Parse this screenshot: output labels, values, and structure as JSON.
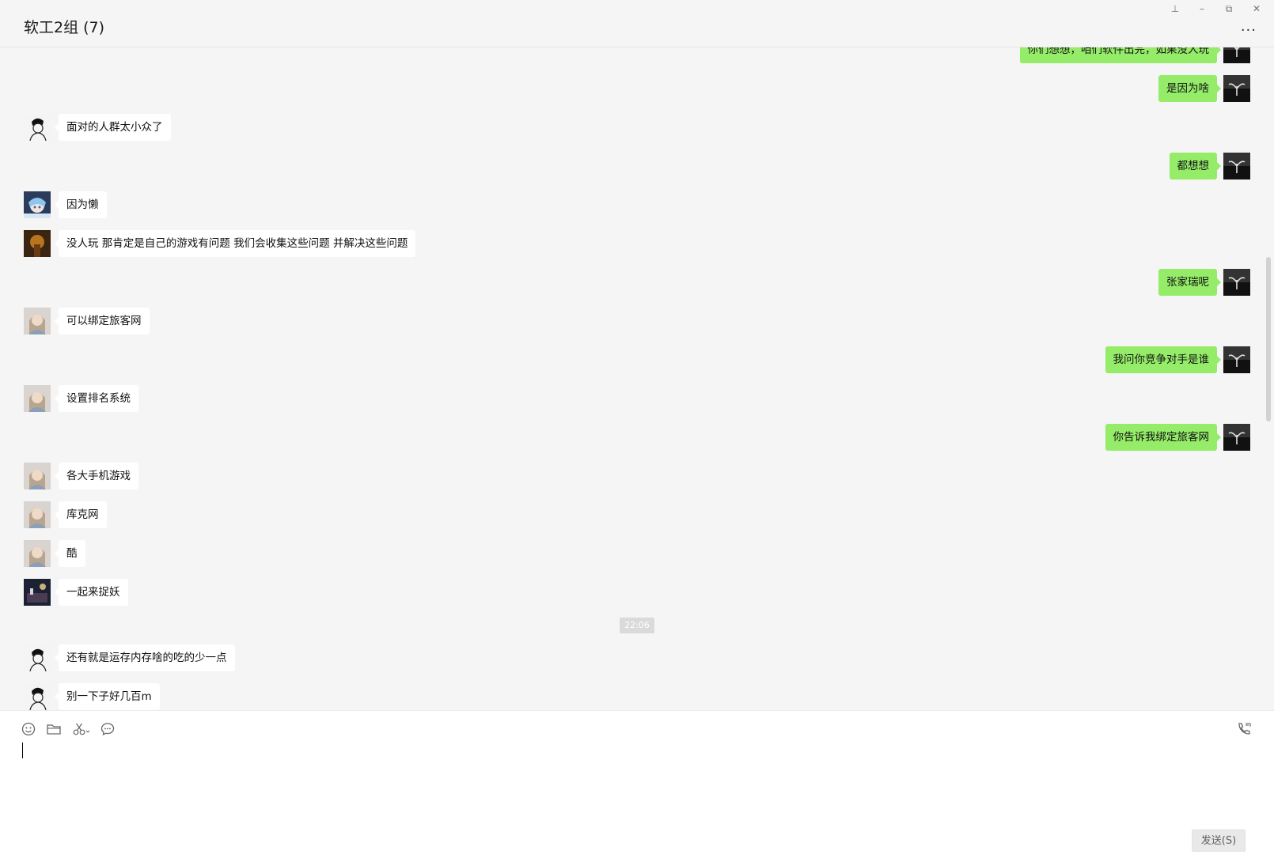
{
  "header": {
    "title": "软工2组 (7)",
    "controls": [
      {
        "name": "pin-icon",
        "glyph": "⊥"
      },
      {
        "name": "minimize-icon",
        "glyph": "–"
      },
      {
        "name": "restore-icon",
        "glyph": "⧉"
      },
      {
        "name": "close-icon",
        "glyph": "✕"
      }
    ],
    "more_glyph": "···"
  },
  "messages": [
    {
      "side": "right",
      "text": "你们想想，咱们软件出完，如果没人玩",
      "avatar": "dark-sprout"
    },
    {
      "side": "right",
      "text": "是因为啥",
      "avatar": "dark-sprout"
    },
    {
      "side": "left",
      "text": "面对的人群太小众了",
      "avatar": "sketch-face"
    },
    {
      "side": "right",
      "text": "都想想",
      "avatar": "dark-sprout"
    },
    {
      "side": "left",
      "text": "因为懒",
      "avatar": "anime-blue"
    },
    {
      "side": "left",
      "text": "没人玩   那肯定是自己的游戏有问题   我们会收集这些问题   并解决这些问题",
      "avatar": "warm-photo"
    },
    {
      "side": "right",
      "text": "张家瑞呢",
      "avatar": "dark-sprout"
    },
    {
      "side": "left",
      "text": "可以绑定旅客网",
      "avatar": "portrait-girl"
    },
    {
      "side": "right",
      "text": "我问你竞争对手是谁",
      "avatar": "dark-sprout"
    },
    {
      "side": "left",
      "text": "设置排名系统",
      "avatar": "portrait-girl"
    },
    {
      "side": "right",
      "text": "你告诉我绑定旅客网",
      "avatar": "dark-sprout"
    },
    {
      "side": "left",
      "text": "各大手机游戏",
      "avatar": "portrait-girl"
    },
    {
      "side": "left",
      "text": "库克网",
      "avatar": "portrait-girl"
    },
    {
      "side": "left",
      "text": "酷",
      "avatar": "portrait-girl"
    },
    {
      "side": "left",
      "text": "一起来捉妖",
      "avatar": "night-photo"
    },
    {
      "side": "left",
      "text": "还有就是运存内存啥的吃的少一点",
      "avatar": "sketch-face"
    },
    {
      "side": "left",
      "text": "别一下子好几百m",
      "avatar": "sketch-face"
    }
  ],
  "timestamp": "22:06",
  "toolbar": {
    "tools": [
      "emoji-icon",
      "folder-icon",
      "scissors-icon",
      "chat-history-icon"
    ],
    "call_icon": "phone-call-icon"
  },
  "input": {
    "value": ""
  },
  "send_label": "发送(S)",
  "colors": {
    "sent_bubble": "#95ec69",
    "received_bubble": "#ffffff",
    "background": "#f5f5f5"
  }
}
